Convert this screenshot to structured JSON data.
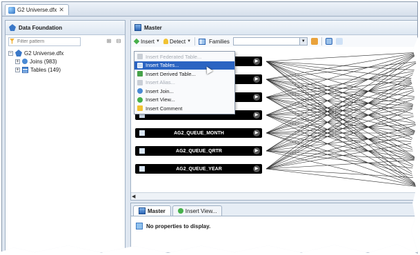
{
  "editor": {
    "tab_title": "G2 Universe.dfx"
  },
  "data_foundation": {
    "title": "Data Foundation",
    "filter_placeholder": "Filter pattern",
    "tree": {
      "root": "G2 Universe.dfx",
      "children": [
        "Joins (983)",
        "Tables (149)"
      ]
    }
  },
  "master": {
    "title": "Master",
    "toolbar": {
      "insert_label": "Insert",
      "detect_label": "Detect",
      "families_label": "Families",
      "families_value": ""
    },
    "tables": [
      "AG2_QUEUE_MONTH",
      "AG2_QUEUE_QRTR",
      "AG2_QUEUE_YEAR"
    ]
  },
  "context_menu": {
    "items": [
      {
        "label": "Insert Federated Table...",
        "enabled": false
      },
      {
        "label": "Insert Tables...",
        "enabled": true,
        "selected": true
      },
      {
        "label": "Insert Derived Table...",
        "enabled": true
      },
      {
        "label": "Insert Alias...",
        "enabled": false
      },
      {
        "label": "Insert Join...",
        "enabled": true
      },
      {
        "label": "Insert View...",
        "enabled": true
      },
      {
        "label": "Insert Comment",
        "enabled": true
      }
    ]
  },
  "bottom_panel": {
    "tabs": [
      "Master",
      "Insert View..."
    ],
    "properties_message": "No properties to display."
  },
  "colors": {
    "accent": "#2b64c2",
    "table_header": "#000000",
    "panel_bg": "#dfe7f1"
  }
}
